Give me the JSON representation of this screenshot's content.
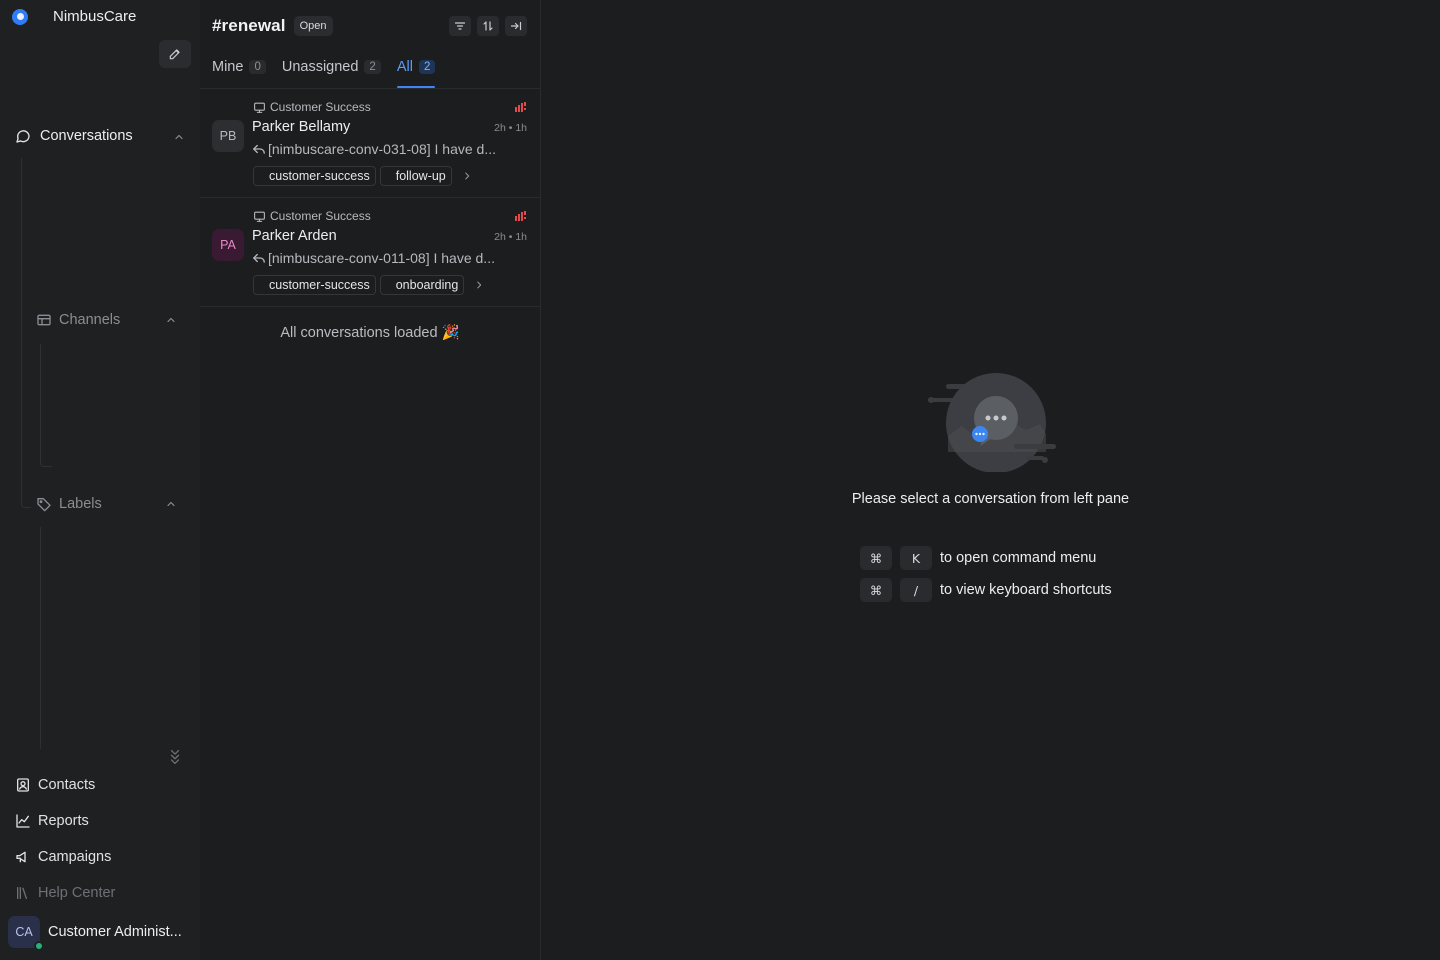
{
  "sidebar": {
    "brand": {
      "name": "NimbusCare",
      "logo_color": "#2f7cf6"
    },
    "compose_icon": "pencil-icon",
    "conversations": {
      "label": "Conversations",
      "icon": "chat-bubble-icon"
    },
    "channels": {
      "label": "Channels",
      "icon": "inbox-icon"
    },
    "labels": {
      "label": "Labels",
      "icon": "tag-icon"
    },
    "bottom_nav": [
      {
        "label": "Contacts",
        "icon": "contact-card-icon"
      },
      {
        "label": "Reports",
        "icon": "chart-line-icon"
      },
      {
        "label": "Campaigns",
        "icon": "megaphone-icon"
      },
      {
        "label": "Help Center",
        "icon": "library-icon"
      }
    ],
    "profile": {
      "initials": "CA",
      "name": "Customer Administ...",
      "status": "online",
      "status_color": "#29b07a"
    }
  },
  "list": {
    "title": "#renewal",
    "status": "Open",
    "tabs": [
      {
        "label": "Mine",
        "count": "0"
      },
      {
        "label": "Unassigned",
        "count": "2"
      },
      {
        "label": "All",
        "count": "2"
      }
    ],
    "active_tab": "All",
    "conversations": [
      {
        "inbox": "Customer Success",
        "initials": "PB",
        "name": "Parker Bellamy",
        "time": "2h • 1h",
        "message": "[nimbuscare-conv-031-08] I have d...",
        "tags": [
          "customer-success",
          "follow-up"
        ],
        "avatar_bg": "#2d2e31",
        "avatar_fg": "#b7babf",
        "priority_color": "#e5484d"
      },
      {
        "inbox": "Customer Success",
        "initials": "PA",
        "name": "Parker Arden",
        "time": "2h • 1h",
        "message": "[nimbuscare-conv-011-08] I have d...",
        "tags": [
          "customer-success",
          "onboarding"
        ],
        "avatar_bg": "#3a1a33",
        "avatar_fg": "#e58ac7",
        "priority_color": "#e5484d"
      }
    ],
    "footer": "All conversations loaded 🎉"
  },
  "empty_state": {
    "message": "Please select a conversation from left pane",
    "shortcuts": [
      {
        "keys": [
          "⌘",
          "K"
        ],
        "label": "to open command menu"
      },
      {
        "keys": [
          "⌘",
          "/"
        ],
        "label": "to view keyboard shortcuts"
      }
    ]
  }
}
